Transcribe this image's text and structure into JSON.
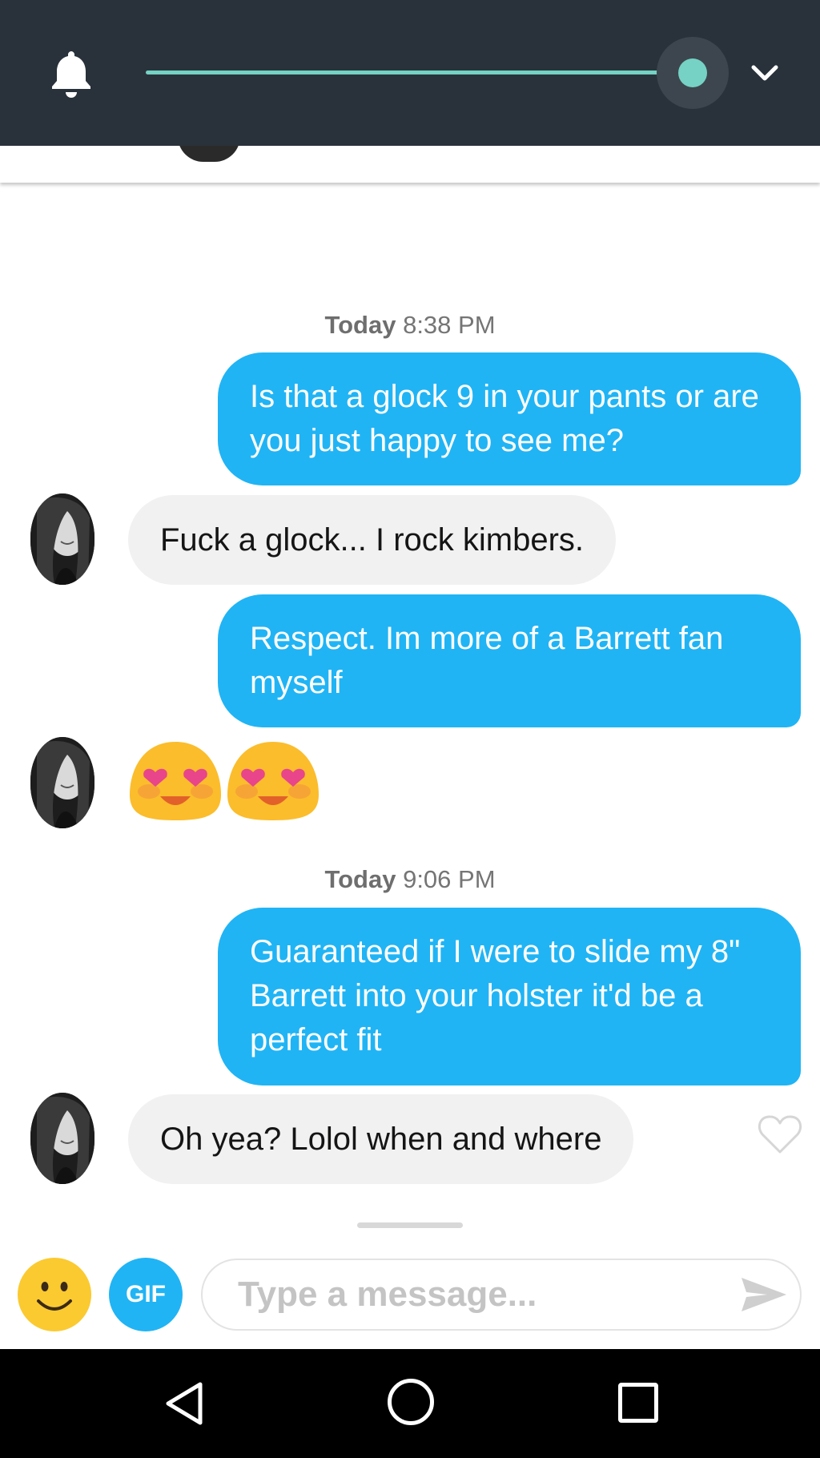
{
  "topbar": {
    "slider_value_percent": 100,
    "accent_color": "#75d2c4",
    "background_color": "#29323a",
    "icons": [
      "bell-icon",
      "chevron-down-icon"
    ]
  },
  "chat": {
    "groups": [
      {
        "timestamp_day": "Today",
        "timestamp_time": "8:38 PM"
      },
      {
        "timestamp_day": "Today",
        "timestamp_time": "9:06 PM"
      }
    ],
    "messages": [
      {
        "from": "me",
        "text": "Is that a glock 9 in your pants or are you just happy to see me?"
      },
      {
        "from": "them",
        "text": "Fuck a glock... I rock kimbers."
      },
      {
        "from": "me",
        "text": "Respect. Im more of a Barrett fan myself"
      },
      {
        "from": "them",
        "emoji": [
          "heart-eyes-emoji",
          "heart-eyes-emoji"
        ]
      },
      {
        "from": "me",
        "text": "Guaranteed if I were to slide my 8\" Barrett into your holster it'd be a perfect fit"
      },
      {
        "from": "them",
        "text": "Oh yea? Lolol when and where"
      }
    ],
    "outgoing_color": "#20b4f5",
    "incoming_color": "#f1f1f2"
  },
  "composer": {
    "gif_label": "GIF",
    "placeholder": "Type a message...",
    "emoji_button_color": "#fbca30",
    "icons": [
      "smiley-icon",
      "send-icon"
    ]
  },
  "navbar": {
    "icons": [
      "back-icon",
      "home-icon",
      "recents-icon"
    ]
  }
}
